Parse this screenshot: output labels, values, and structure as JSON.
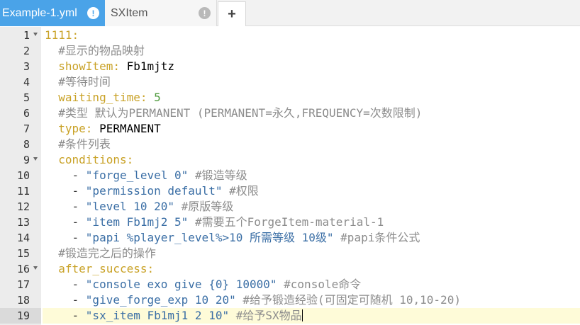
{
  "tabs": [
    {
      "label": "Example-1.yml",
      "badge": "!",
      "active": true
    },
    {
      "label": "SXItem",
      "badge": "!",
      "active": false
    }
  ],
  "add_tab_label": "+",
  "colors": {
    "active_tab": "#4aa3e8",
    "key": "#c9a227",
    "comment": "#8c8c8c",
    "string": "#3a6ea5",
    "number": "#4e9a3c",
    "active_line": "#fefbd8"
  },
  "icons": {
    "tab_badge": "info-icon",
    "fold": "fold-arrow-icon"
  },
  "editor": {
    "lines": [
      {
        "num": "1",
        "fold": true,
        "tokens": [
          {
            "t": "k",
            "x": "1111:"
          }
        ]
      },
      {
        "num": "2",
        "tokens": [
          {
            "t": "p",
            "x": "  "
          },
          {
            "t": "c",
            "x": "#显示的物品映射"
          }
        ]
      },
      {
        "num": "3",
        "tokens": [
          {
            "t": "p",
            "x": "  "
          },
          {
            "t": "k",
            "x": "showItem:"
          },
          {
            "t": "v",
            "x": " Fb1mjtz"
          }
        ]
      },
      {
        "num": "4",
        "tokens": [
          {
            "t": "p",
            "x": "  "
          },
          {
            "t": "c",
            "x": "#等待时间"
          }
        ]
      },
      {
        "num": "5",
        "tokens": [
          {
            "t": "p",
            "x": "  "
          },
          {
            "t": "k",
            "x": "waiting_time:"
          },
          {
            "t": "p",
            "x": " "
          },
          {
            "t": "n",
            "x": "5"
          }
        ]
      },
      {
        "num": "6",
        "tokens": [
          {
            "t": "p",
            "x": "  "
          },
          {
            "t": "c",
            "x": "#类型 默认为PERMANENT (PERMANENT=永久,FREQUENCY=次数限制)"
          }
        ]
      },
      {
        "num": "7",
        "tokens": [
          {
            "t": "p",
            "x": "  "
          },
          {
            "t": "k",
            "x": "type:"
          },
          {
            "t": "v",
            "x": " PERMANENT"
          }
        ]
      },
      {
        "num": "8",
        "tokens": [
          {
            "t": "p",
            "x": "  "
          },
          {
            "t": "c",
            "x": "#条件列表"
          }
        ]
      },
      {
        "num": "9",
        "fold": true,
        "tokens": [
          {
            "t": "p",
            "x": "  "
          },
          {
            "t": "k",
            "x": "conditions:"
          }
        ]
      },
      {
        "num": "10",
        "tokens": [
          {
            "t": "p",
            "x": "    - "
          },
          {
            "t": "s",
            "x": "\"forge_level 0\""
          },
          {
            "t": "p",
            "x": " "
          },
          {
            "t": "c",
            "x": "#锻造等级"
          }
        ]
      },
      {
        "num": "11",
        "tokens": [
          {
            "t": "p",
            "x": "    - "
          },
          {
            "t": "s",
            "x": "\"permission default\""
          },
          {
            "t": "p",
            "x": " "
          },
          {
            "t": "c",
            "x": "#权限"
          }
        ]
      },
      {
        "num": "12",
        "tokens": [
          {
            "t": "p",
            "x": "    - "
          },
          {
            "t": "s",
            "x": "\"level 10 20\""
          },
          {
            "t": "p",
            "x": " "
          },
          {
            "t": "c",
            "x": "#原版等级"
          }
        ]
      },
      {
        "num": "13",
        "tokens": [
          {
            "t": "p",
            "x": "    - "
          },
          {
            "t": "s",
            "x": "\"item Fb1mj2 5\""
          },
          {
            "t": "p",
            "x": " "
          },
          {
            "t": "c",
            "x": "#需要五个ForgeItem-material-1"
          }
        ]
      },
      {
        "num": "14",
        "tokens": [
          {
            "t": "p",
            "x": "    - "
          },
          {
            "t": "s",
            "x": "\"papi %player_level%>10 所需等级 10级\""
          },
          {
            "t": "p",
            "x": " "
          },
          {
            "t": "c",
            "x": "#papi条件公式"
          }
        ]
      },
      {
        "num": "15",
        "tokens": [
          {
            "t": "p",
            "x": "  "
          },
          {
            "t": "c",
            "x": "#锻造完之后的操作"
          }
        ]
      },
      {
        "num": "16",
        "fold": true,
        "tokens": [
          {
            "t": "p",
            "x": "  "
          },
          {
            "t": "k",
            "x": "after_success:"
          }
        ]
      },
      {
        "num": "17",
        "tokens": [
          {
            "t": "p",
            "x": "    - "
          },
          {
            "t": "s",
            "x": "\"console exo give {0} 10000\""
          },
          {
            "t": "p",
            "x": " "
          },
          {
            "t": "c",
            "x": "#console命令"
          }
        ]
      },
      {
        "num": "18",
        "tokens": [
          {
            "t": "p",
            "x": "    - "
          },
          {
            "t": "s",
            "x": "\"give_forge_exp 10 20\""
          },
          {
            "t": "p",
            "x": " "
          },
          {
            "t": "c",
            "x": "#给予锻造经验(可固定可随机 10,10-20)"
          }
        ]
      },
      {
        "num": "19",
        "active": true,
        "cursor": true,
        "tokens": [
          {
            "t": "p",
            "x": "    - "
          },
          {
            "t": "s",
            "x": "\"sx_item Fb1mj1 2 10\""
          },
          {
            "t": "p",
            "x": " "
          },
          {
            "t": "c",
            "x": "#给予SX物品"
          }
        ]
      }
    ]
  }
}
